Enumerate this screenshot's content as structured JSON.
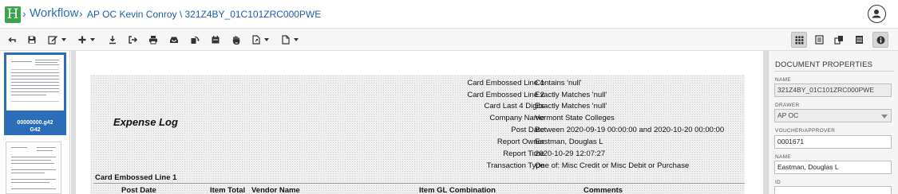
{
  "header": {
    "workflow_label": "Workflow",
    "document_title": "AP OC Kevin Conroy \\ 321Z4BY_01C101ZRC000PWE"
  },
  "toolbar": {
    "left_icons": [
      "back-icon",
      "save-icon",
      "edit-icon",
      "add-icon",
      "download-icon",
      "export-icon",
      "print-icon",
      "inbox-icon",
      "rotate-icon",
      "stamp-icon",
      "hand-icon",
      "page-icon",
      "document-icon"
    ],
    "view_icons": [
      "grid-view-icon",
      "list-view-icon",
      "split-view-icon",
      "table-view-icon",
      "info-icon"
    ]
  },
  "thumbnails": {
    "items": [
      {
        "caption": "00000000.g42",
        "sub": "G42",
        "selected": true
      },
      {
        "caption": "",
        "sub": "",
        "selected": false
      }
    ]
  },
  "report": {
    "title": "Expense Log",
    "criteria": [
      {
        "label": "Card Embossed Line 1",
        "value": "Contains 'null'"
      },
      {
        "label": "Card Embossed Line 2",
        "value": "Exactly Matches 'null'"
      },
      {
        "label": "Card Last 4 Digits",
        "value": "Exactly Matches 'null'"
      },
      {
        "label": "Company Name",
        "value": "Vermont State Colleges"
      },
      {
        "label": "Post Date",
        "value": "Between 2020-09-19 00:00:00 and 2020-10-20 00:00:00"
      },
      {
        "label": "Report Owner",
        "value": "Eastman, Douglas L"
      },
      {
        "label": "Report Time",
        "value": "2020-10-29 12:07:27"
      },
      {
        "label": "Transaction Type",
        "value": "One of: Misc Credit or Misc Debit or Purchase"
      }
    ],
    "section_header": "Card Embossed Line 1",
    "columns": [
      "Post Date",
      "Item Total",
      "Vendor Name",
      "Item GL Combination",
      "Comments"
    ]
  },
  "properties": {
    "title": "DOCUMENT PROPERTIES",
    "fields": [
      {
        "label": "NAME",
        "value": "321Z4BY_01C101ZRC000PWE",
        "readonly": true,
        "select": false
      },
      {
        "label": "DRAWER",
        "value": "AP OC",
        "readonly": true,
        "select": true
      },
      {
        "label": "VOUCHER/APPROVER",
        "value": "0001671",
        "readonly": false,
        "select": false
      },
      {
        "label": "NAME",
        "value": "Eastman, Douglas L",
        "readonly": false,
        "select": false
      },
      {
        "label": "ID",
        "value": "",
        "readonly": false,
        "select": false
      }
    ]
  },
  "colors": {
    "logo_green": "#3fa34d",
    "link_blue": "#2a6fb8",
    "thumb_selected": "#2b6db8"
  }
}
